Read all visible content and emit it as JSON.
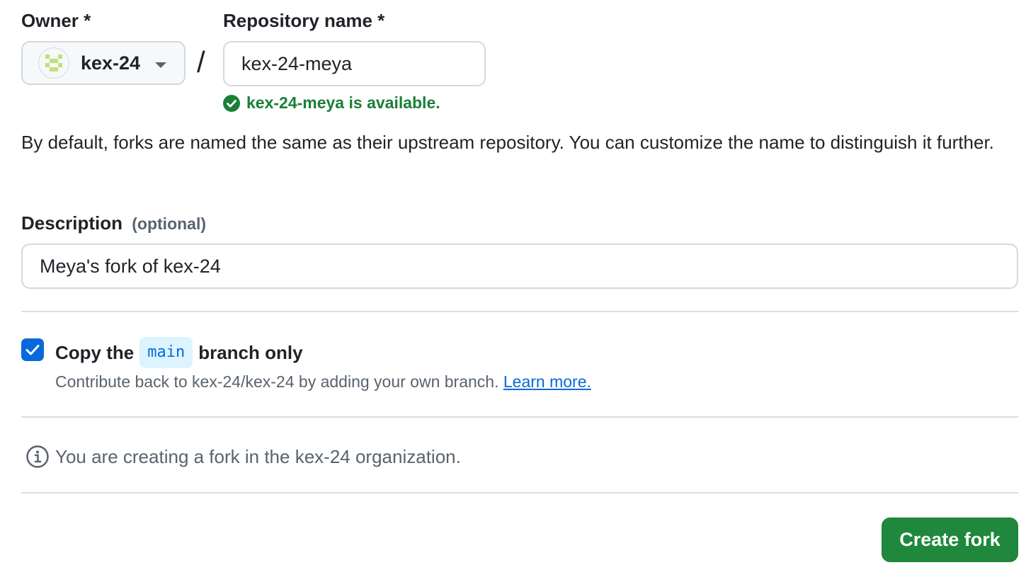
{
  "owner": {
    "label": "Owner *",
    "selected": "kex-24",
    "avatar_icon": "identicon",
    "avatar_color": "#c2e07a"
  },
  "separator": "/",
  "repository": {
    "label": "Repository name *",
    "value": "kex-24-meya",
    "availability": "kex-24-meya is available.",
    "availability_color": "#1a7f37"
  },
  "helper_text": "By default, forks are named the same as their upstream repository. You can customize the name to distinguish it further.",
  "description": {
    "label": "Description",
    "optional": "(optional)",
    "value": "Meya's fork of kex-24"
  },
  "copy_branch": {
    "checked": true,
    "prefix": "Copy the",
    "branch": "main",
    "suffix": "branch only",
    "subtext": "Contribute back to kex-24/kex-24 by adding your own branch.",
    "link": "Learn more."
  },
  "info_text": "You are creating a fork in the kex-24 organization.",
  "submit_label": "Create fork",
  "colors": {
    "accent": "#0969da",
    "success": "#1a7f37",
    "button": "#1f883d"
  }
}
